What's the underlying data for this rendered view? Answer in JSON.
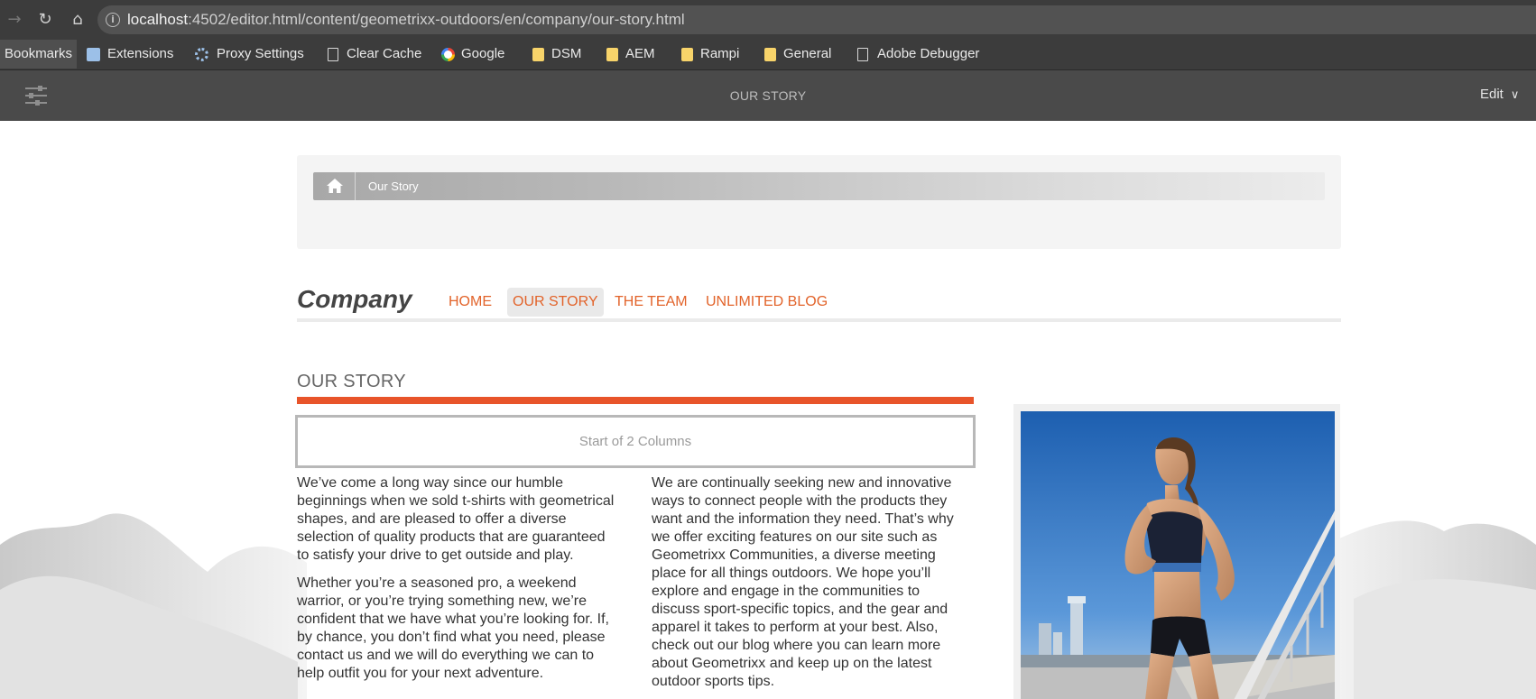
{
  "browser": {
    "url_host": "localhost",
    "url_rest": ":4502/editor.html/content/geometrixx-outdoors/en/company/our-story.html",
    "bookmarks": [
      {
        "label": "Bookmarks",
        "icon": null
      },
      {
        "label": "Extensions",
        "icon": "puzzle-icon"
      },
      {
        "label": "Proxy Settings",
        "icon": "gear-icon"
      },
      {
        "label": "Clear Cache",
        "icon": "page-icon"
      },
      {
        "label": "Google",
        "icon": "google-icon"
      },
      {
        "label": "DSM",
        "icon": "folder-icon"
      },
      {
        "label": "AEM",
        "icon": "folder-icon"
      },
      {
        "label": "Rampi",
        "icon": "folder-icon"
      },
      {
        "label": "General",
        "icon": "folder-icon"
      },
      {
        "label": "Adobe Debugger",
        "icon": "page-icon"
      }
    ]
  },
  "editor": {
    "title": "OUR STORY",
    "mode_label": "Edit"
  },
  "page": {
    "breadcrumb": {
      "current": "Our Story"
    },
    "brand": "Company",
    "nav": [
      {
        "label": "HOME",
        "active": false
      },
      {
        "label": "OUR STORY",
        "active": true
      },
      {
        "label": "THE TEAM",
        "active": false
      },
      {
        "label": "UNLIMITED BLOG",
        "active": false
      }
    ],
    "heading": "OUR STORY",
    "columns_placeholder": "Start of 2 Columns",
    "column1": [
      "We’ve come a long way since our humble beginnings when we sold t-shirts with geometrical shapes, and are pleased to offer a diverse selection of quality products that are guaranteed to satisfy your drive to get outside and play.",
      "Whether you’re a seasoned pro, a weekend warrior, or you’re trying something new, we’re confident that we have what you’re looking for. If, by chance, you don’t find what you need, please contact us and we will do everything we can to help outfit you for your next adventure."
    ],
    "column2": [
      "We are continually seeking new and innovative ways to connect people with the products they want and the information they need. That’s why we offer exciting features on our site such as Geometrixx Communities, a diverse meeting place for all things outdoors. We hope you’ll explore and engage in the communities to discuss sport-specific topics, and the gear and apparel it takes to perform at your best. Also, check out our blog where you can learn more about Geometrixx and keep up on the latest outdoor sports tips."
    ]
  },
  "colors": {
    "accent": "#e8542a",
    "nav_link": "#e2632a",
    "editor_bar": "#4a4a4a"
  }
}
